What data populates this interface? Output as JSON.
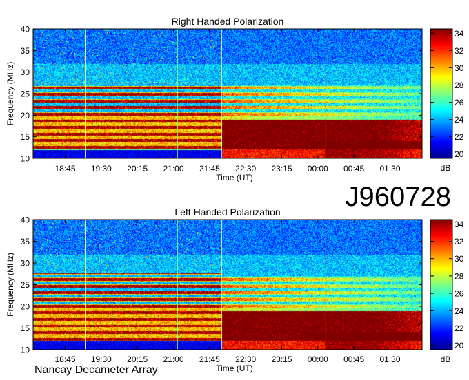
{
  "observation_label": "J960728",
  "credit": "Nancay Decameter Array",
  "colors": {
    "colormap": [
      "#00008f",
      "#0000ff",
      "#0080ff",
      "#00ffff",
      "#80ff80",
      "#ffff00",
      "#ff8000",
      "#ff0000",
      "#800000"
    ]
  },
  "chart_data": [
    {
      "type": "heatmap",
      "title": "Right Handed Polarization",
      "xlabel": "Time (UT)",
      "ylabel": "Frequency (MHz)",
      "colorbar_label": "dB",
      "x_ticks": [
        "18:45",
        "19:30",
        "20:15",
        "21:00",
        "21:45",
        "22:30",
        "23:15",
        "00:00",
        "00:45",
        "01:30"
      ],
      "y_ticks": [
        10,
        15,
        20,
        25,
        30,
        35,
        40
      ],
      "ylim": [
        10,
        40
      ],
      "colorbar_ticks": [
        20,
        22,
        24,
        26,
        28,
        30,
        32,
        34
      ],
      "clim": [
        19.5,
        34.5
      ],
      "time_range": [
        "18:05",
        "02:10"
      ],
      "vertical_lines": [
        {
          "time": "19:10",
          "color": "#ffff80"
        },
        {
          "time": "21:05",
          "color": "#80ff80"
        },
        {
          "time": "22:00",
          "color": "#ffff80"
        },
        {
          "time": "00:10",
          "color": "#ff4000"
        }
      ]
    },
    {
      "type": "heatmap",
      "title": "Left Handed Polarization",
      "xlabel": "Time (UT)",
      "ylabel": "Frequency (MHz)",
      "colorbar_label": "dB",
      "x_ticks": [
        "18:45",
        "19:30",
        "20:15",
        "21:00",
        "21:45",
        "22:30",
        "23:15",
        "00:00",
        "00:45",
        "01:30"
      ],
      "y_ticks": [
        10,
        15,
        20,
        25,
        30,
        35,
        40
      ],
      "ylim": [
        10,
        40
      ],
      "colorbar_ticks": [
        20,
        22,
        24,
        26,
        28,
        30,
        32,
        34
      ],
      "clim": [
        19.5,
        34.5
      ],
      "time_range": [
        "18:05",
        "02:10"
      ],
      "vertical_lines": [
        {
          "time": "19:10",
          "color": "#ffff80"
        },
        {
          "time": "21:05",
          "color": "#80ff80"
        },
        {
          "time": "22:00",
          "color": "#ffff80"
        },
        {
          "time": "00:10",
          "color": "#ff4000"
        }
      ]
    }
  ]
}
